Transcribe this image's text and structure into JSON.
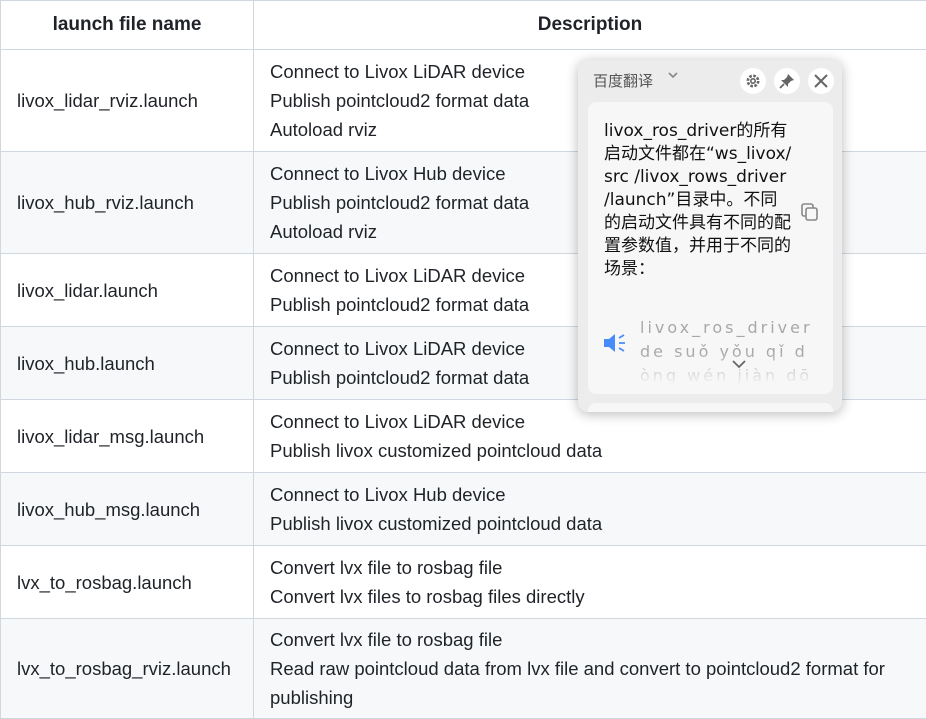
{
  "table": {
    "headers": [
      "launch file name",
      "Description"
    ],
    "rows": [
      {
        "name": "livox_lidar_rviz.launch",
        "desc": [
          "Connect to Livox LiDAR device",
          "Publish pointcloud2 format data",
          "Autoload rviz"
        ]
      },
      {
        "name": "livox_hub_rviz.launch",
        "desc": [
          "Connect to Livox Hub device",
          "Publish pointcloud2 format data",
          "Autoload rviz"
        ]
      },
      {
        "name": "livox_lidar.launch",
        "desc": [
          "Connect to Livox LiDAR device",
          "Publish pointcloud2 format data"
        ]
      },
      {
        "name": "livox_hub.launch",
        "desc": [
          "Connect to Livox LiDAR device",
          "Publish pointcloud2 format data"
        ]
      },
      {
        "name": "livox_lidar_msg.launch",
        "desc": [
          "Connect to Livox LiDAR device",
          "Publish livox customized pointcloud data"
        ]
      },
      {
        "name": "livox_hub_msg.launch",
        "desc": [
          "Connect to Livox Hub device",
          "Publish livox customized pointcloud data"
        ]
      },
      {
        "name": "lvx_to_rosbag.launch",
        "desc": [
          "Convert lvx file to rosbag file",
          "Convert lvx files to rosbag files directly"
        ]
      },
      {
        "name": "lvx_to_rosbag_rviz.launch",
        "desc": [
          "Convert lvx file to rosbag file",
          "Read raw pointcloud data from lvx file and convert to pointcloud2 format for publishing"
        ]
      }
    ]
  },
  "translate_popup": {
    "title": "百度翻译",
    "translation": "livox_ros_driver的所有启动文件都在“ws_livox/src /livox_rows_driver /launch”目录中。不同的启动文件具有不同的配置参数值，并用于不同的场景：",
    "pinyin": "livox_ros_driver de suǒ yǒu qǐ dòng wén jiàn dōu",
    "icons": [
      "chevron-down-icon",
      "gear-icon",
      "pin-icon",
      "close-icon",
      "copy-icon",
      "speaker-icon"
    ]
  }
}
